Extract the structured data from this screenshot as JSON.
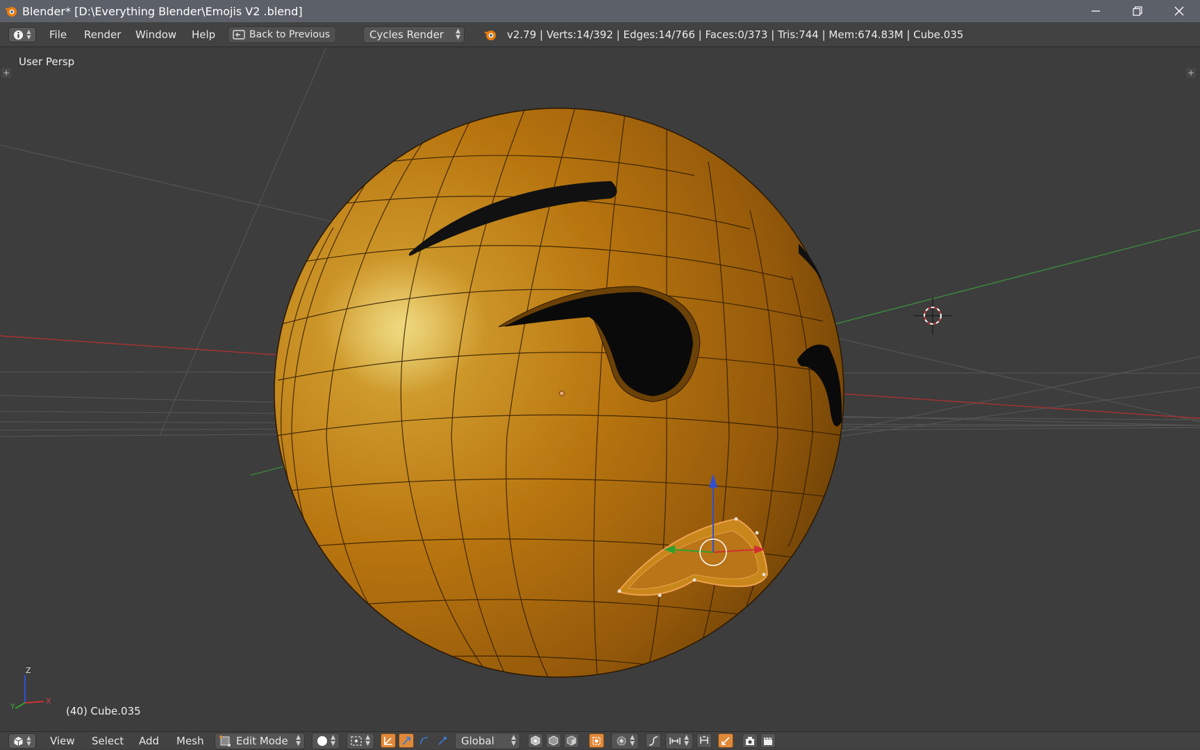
{
  "window": {
    "title": "Blender* [D:\\Everything Blender\\Emojis V2 .blend]",
    "controls": [
      "minimize-icon",
      "restore-icon",
      "close-icon"
    ]
  },
  "info_header": {
    "menus": [
      "File",
      "Render",
      "Window",
      "Help"
    ],
    "back_button": "Back to Previous",
    "render_engine": "Cycles Render",
    "stats": "v2.79 | Verts:14/392 | Edges:14/766 | Faces:0/373 | Tris:744 | Mem:674.83M | Cube.035"
  },
  "viewport": {
    "view_label": "User Persp",
    "object_label": "(40) Cube.035",
    "axes": {
      "x": "X",
      "y": "Y",
      "z": "Z"
    }
  },
  "view3d_header": {
    "menus": [
      "View",
      "Select",
      "Add",
      "Mesh"
    ],
    "mode": "Edit Mode",
    "orientation": "Global"
  },
  "colors": {
    "accent": "#e0893a",
    "viewport_bg": "#3d3d3d",
    "sphere": "#c07a16",
    "axis_x": "#c84040",
    "axis_y": "#3c9a3c",
    "axis_z": "#3050d0"
  }
}
